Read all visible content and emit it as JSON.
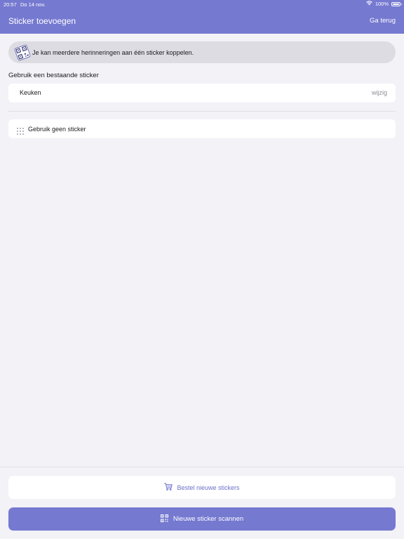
{
  "status_bar": {
    "time": "20:57",
    "date": "Do 14 nov.",
    "battery": "100%"
  },
  "nav": {
    "title": "Sticker toevoegen",
    "back_label": "Ga terug"
  },
  "info_banner": {
    "text": "Je kan meerdere herinneringen aan één sticker koppelen."
  },
  "existing": {
    "section_label": "Gebruik een bestaande sticker",
    "sticker_name": "Keuken",
    "edit_label": "wijzig"
  },
  "no_sticker": {
    "label": "Gebruik geen sticker"
  },
  "actions": {
    "order_label": "Bestel nieuwe stickers",
    "scan_label": "Nieuwe sticker scannen"
  },
  "colors": {
    "accent": "#7579d0",
    "background": "#f2f2f7"
  }
}
